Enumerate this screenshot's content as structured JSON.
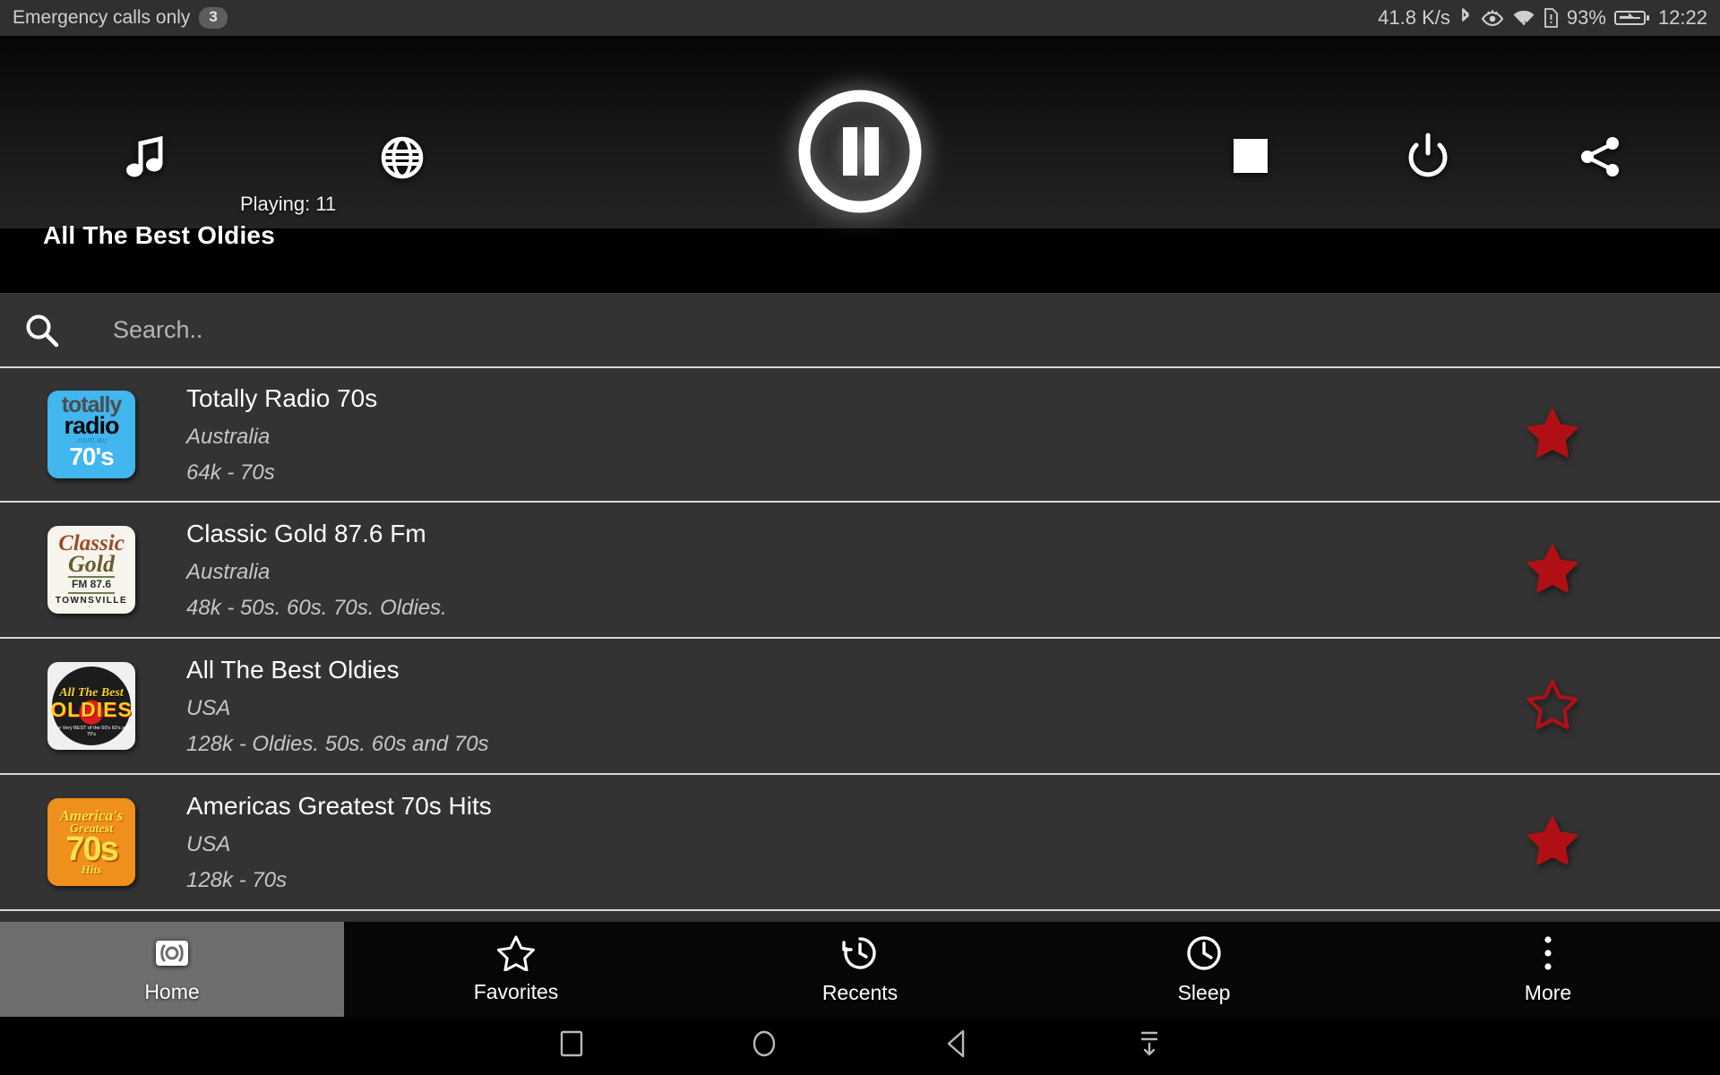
{
  "status_bar": {
    "carrier_text": "Emergency calls only",
    "notification_count": "3",
    "network_speed": "41.8 K/s",
    "battery_percent": "93%",
    "clock": "12:22",
    "icons": [
      "bluetooth-icon",
      "eye-icon",
      "wifi-icon",
      "sim-alert-icon",
      "battery-charging-icon"
    ]
  },
  "player": {
    "music_icon": "music-note-icon",
    "globe_icon": "globe-icon",
    "playing_label": "Playing: 11",
    "pause_icon": "pause-circle-icon",
    "stop_icon": "stop-square-icon",
    "power_icon": "power-icon",
    "share_icon": "share-icon",
    "now_playing_title": "All The Best Oldies"
  },
  "search": {
    "icon": "search-icon",
    "placeholder": "Search..",
    "value": ""
  },
  "stations": [
    {
      "logo": "totally-radio-70s-logo",
      "logo_text": {
        "l1": "totally",
        "l2": "radio",
        "l3": ".com.au",
        "l4": "70's"
      },
      "name": "Totally Radio 70s",
      "country": "Australia",
      "details": "64k - 70s",
      "favorite": true
    },
    {
      "logo": "classic-gold-logo",
      "logo_text": {
        "l1": "Classic",
        "l2": "Gold",
        "l3": "FM 87.6",
        "l4": "TOWNSVILLE"
      },
      "name": "Classic Gold 87.6 Fm",
      "country": "Australia",
      "details": "48k - 50s. 60s. 70s. Oldies.",
      "favorite": true
    },
    {
      "logo": "all-the-best-oldies-logo",
      "logo_text": {
        "l1": "All The Best",
        "l2": "OLDIES",
        "l3": "The Very BEST of the 50's 60's and 70's",
        "l4": ""
      },
      "name": "All The Best Oldies",
      "country": "USA",
      "details": "128k - Oldies. 50s. 60s and 70s",
      "favorite": false
    },
    {
      "logo": "americas-greatest-70s-hits-logo",
      "logo_text": {
        "l1": "America's",
        "l2": "Greatest",
        "l3": "70s",
        "l4": "Hits"
      },
      "name": "Americas Greatest 70s Hits",
      "country": "USA",
      "details": "128k - 70s",
      "favorite": true
    }
  ],
  "tabs": [
    {
      "label": "Home",
      "icon": "radio-broadcast-icon",
      "active": true
    },
    {
      "label": "Favorites",
      "icon": "star-outline-icon",
      "active": false
    },
    {
      "label": "Recents",
      "icon": "history-icon",
      "active": false
    },
    {
      "label": "Sleep",
      "icon": "clock-icon",
      "active": false
    },
    {
      "label": "More",
      "icon": "overflow-dots-icon",
      "active": false
    }
  ],
  "android_nav": [
    {
      "icon": "recents-square-icon"
    },
    {
      "icon": "home-circle-icon"
    },
    {
      "icon": "back-triangle-icon"
    },
    {
      "icon": "hide-keyboard-icon"
    }
  ],
  "colors": {
    "favorite_star": "#b01015",
    "list_background": "#333333",
    "active_tab": "#6e6e6e"
  }
}
